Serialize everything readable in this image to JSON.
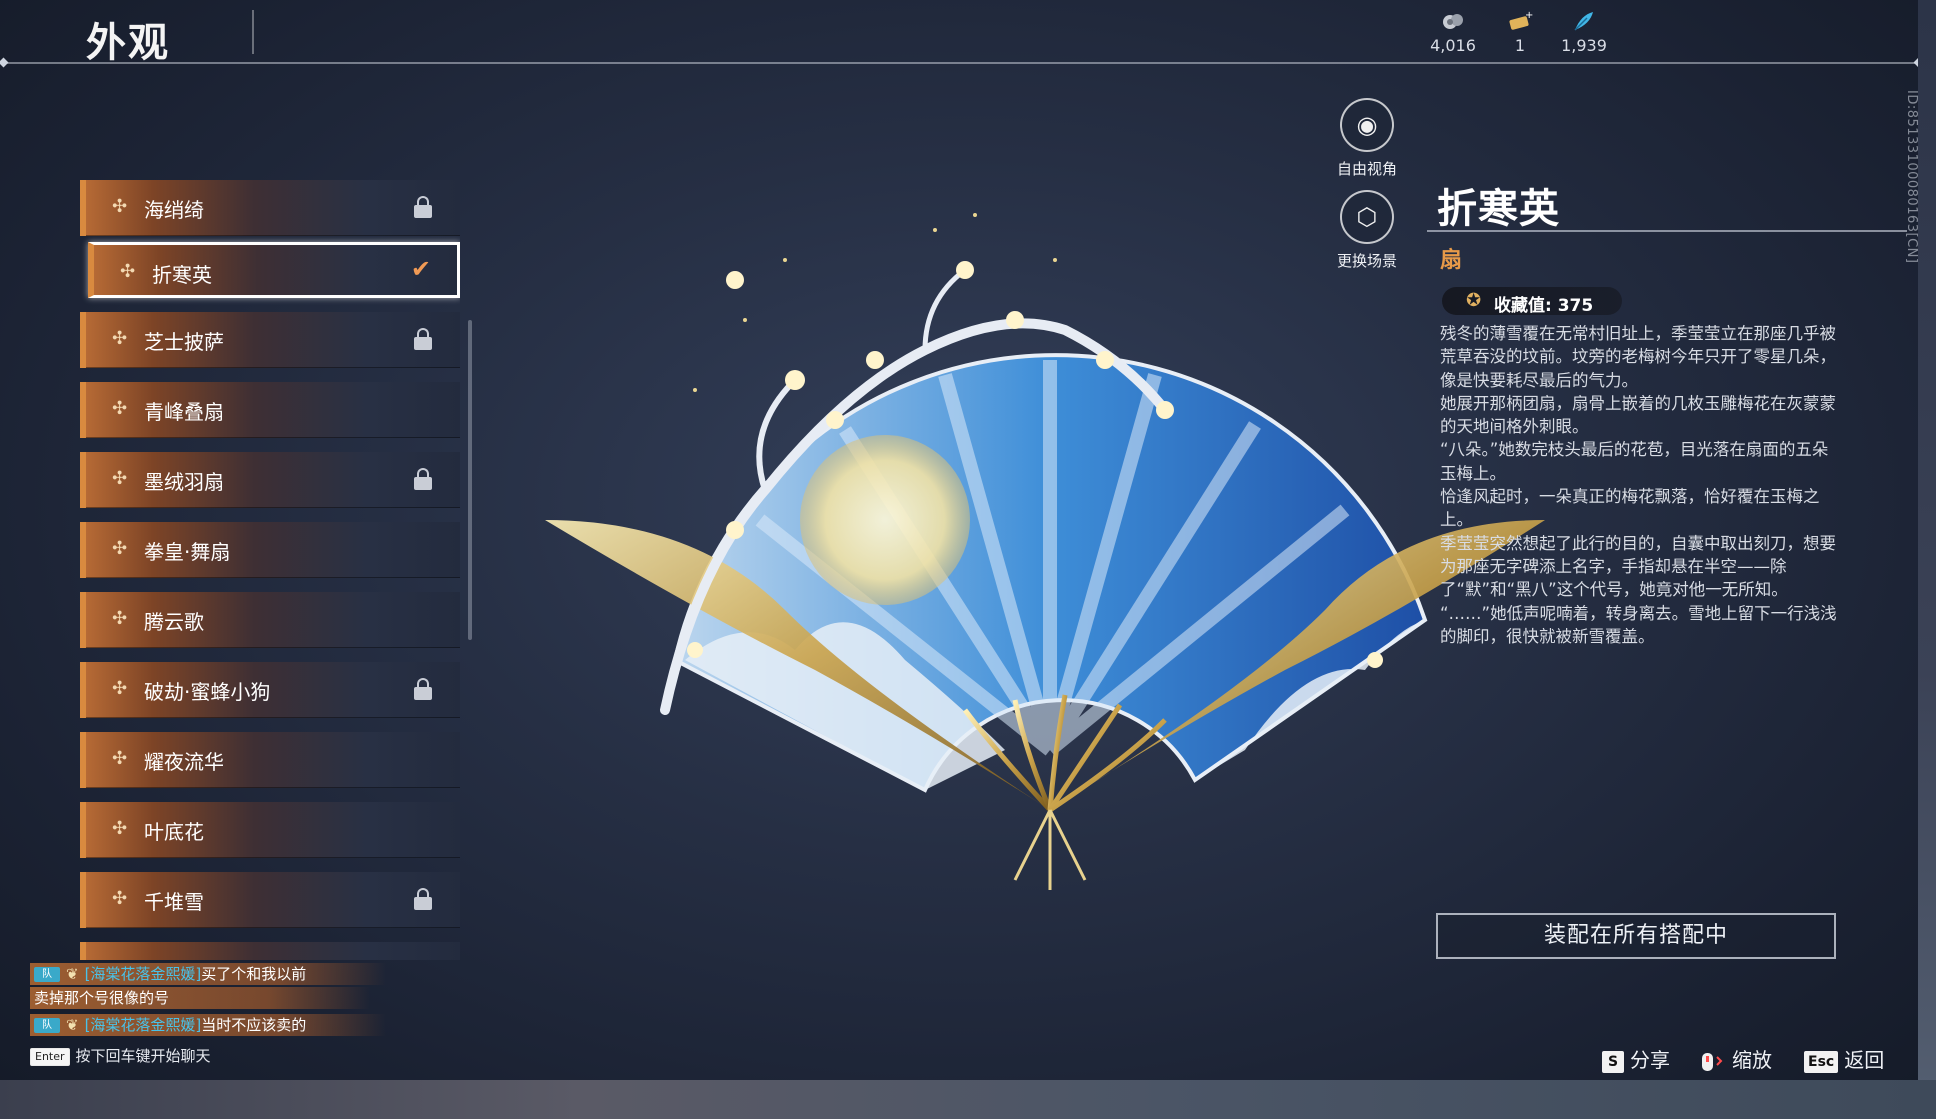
{
  "header": {
    "title": "外观",
    "currencies": [
      {
        "icon": "ore-icon",
        "value": "4,016"
      },
      {
        "icon": "ticket-icon",
        "value": "1"
      },
      {
        "icon": "feather-icon",
        "value": "1,939"
      }
    ]
  },
  "side_id": "ID:85133100080163[CN]",
  "list": {
    "items": [
      {
        "label": "海绡绮",
        "status": "locked"
      },
      {
        "label": "折寒英",
        "status": "selected"
      },
      {
        "label": "芝士披萨",
        "status": "locked"
      },
      {
        "label": "青峰叠扇",
        "status": ""
      },
      {
        "label": "墨绒羽扇",
        "status": "locked"
      },
      {
        "label": "拳皇·舞扇",
        "status": ""
      },
      {
        "label": "腾云歌",
        "status": ""
      },
      {
        "label": "破劫·蜜蜂小狗",
        "status": "locked"
      },
      {
        "label": "耀夜流华",
        "status": ""
      },
      {
        "label": "叶底花",
        "status": ""
      },
      {
        "label": "千堆雪",
        "status": "locked"
      }
    ]
  },
  "view_controls": {
    "free_camera": "自由视角",
    "change_scene": "更换场景"
  },
  "detail": {
    "name": "折寒英",
    "type": "扇",
    "collection": "收藏值: 375",
    "story": [
      "残冬的薄雪覆在无常村旧址上，季莹莹立在那座几乎被荒草吞没的坟前。坟旁的老梅树今年只开了零星几朵，像是快要耗尽最后的气力。",
      "她展开那柄团扇，扇骨上嵌着的几枚玉雕梅花在灰蒙蒙的天地间格外刺眼。",
      "“八朵。”她数完枝头最后的花苞，目光落在扇面的五朵玉梅上。",
      "恰逢风起时，一朵真正的梅花飘落，恰好覆在玉梅之上。",
      "季莹莹突然想起了此行的目的，自囊中取出刻刀，想要为那座无字碑添上名字，手指却悬在半空——除了“默”和“黑八”这个代号，她竟对他一无所知。",
      "“……”她低声呢喃着，转身离去。雪地上留下一行浅浅的脚印，很快就被新雪覆盖。"
    ],
    "equip_button": "装配在所有搭配中"
  },
  "chat": {
    "messages": [
      {
        "tag": "队",
        "user": "[海棠花落金熙媛]",
        "text": "买了个和我以前"
      },
      {
        "tag": "",
        "user": "",
        "text": "卖掉那个号很像的号"
      },
      {
        "tag": "队",
        "user": "[海棠花落金熙媛]",
        "text": "当时不应该卖的"
      }
    ],
    "enter_key": "Enter",
    "hint": "按下回车键开始聊天"
  },
  "hotkeys": [
    {
      "key": "S",
      "label": "分享"
    },
    {
      "key": "",
      "label": "缩放"
    },
    {
      "key": "Esc",
      "label": "返回"
    }
  ],
  "colors": {
    "accent_orange": "#e79a49",
    "check_orange": "#f09a55",
    "chat_user_blue": "#49c2e8",
    "background": "#262f44"
  }
}
